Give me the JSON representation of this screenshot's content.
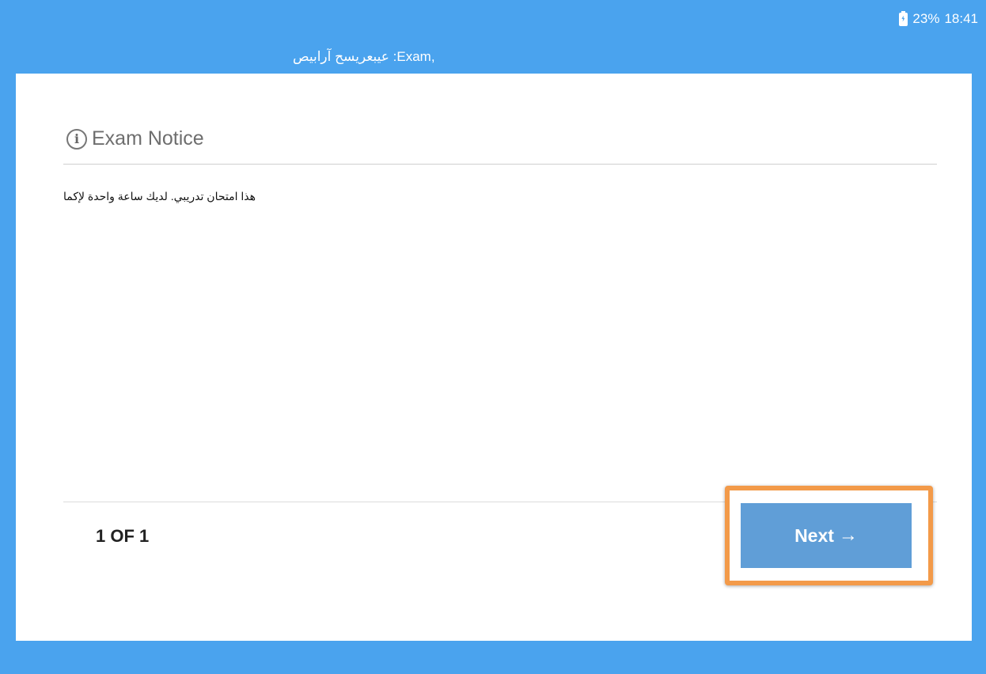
{
  "status_bar": {
    "battery_percent": "23%",
    "time": "18:41"
  },
  "header": {
    "title": "عيبعريسح آرابيص :Exam,"
  },
  "notice": {
    "title": "Exam Notice",
    "body": "هذا امتحان تدريبي. لديك ساعة واحدة لإكما"
  },
  "footer": {
    "page_counter": "1 OF 1",
    "next_label": "Next",
    "next_arrow": "→"
  },
  "colors": {
    "background": "#4aa3ee",
    "next_button": "#609ed7",
    "highlight": "#f39a49"
  }
}
